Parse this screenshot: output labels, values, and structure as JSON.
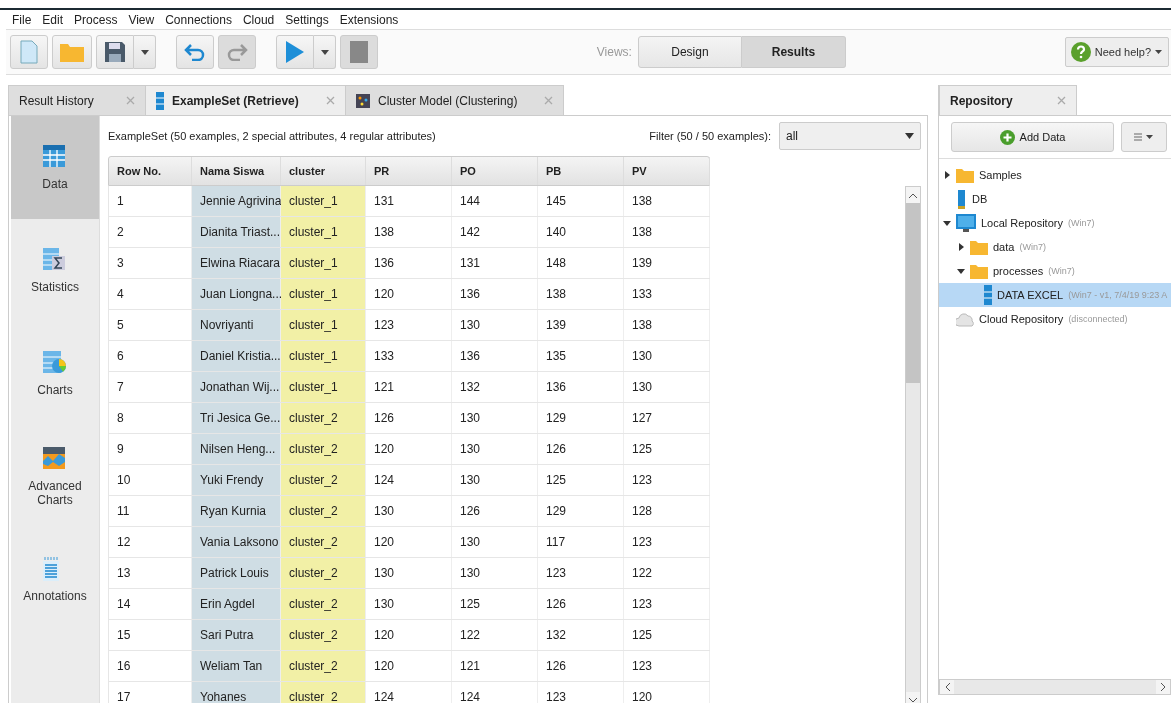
{
  "menu": [
    "File",
    "Edit",
    "Process",
    "View",
    "Connections",
    "Cloud",
    "Settings",
    "Extensions"
  ],
  "toolbar": {
    "views_label": "Views:",
    "views": [
      {
        "label": "Design",
        "selected": false
      },
      {
        "label": "Results",
        "selected": true
      }
    ],
    "help": "Need help?"
  },
  "result_tabs": [
    {
      "label": "Result History",
      "kind": "plain",
      "selected": false
    },
    {
      "label": "ExampleSet (Retrieve)",
      "kind": "table",
      "selected": true
    },
    {
      "label": "Cluster Model (Clustering)",
      "kind": "model",
      "selected": false
    }
  ],
  "side_nav": [
    {
      "label": "Data",
      "kind": "data",
      "selected": true
    },
    {
      "label": "Statistics",
      "kind": "statistics",
      "selected": false
    },
    {
      "label": "Charts",
      "kind": "charts",
      "selected": false
    },
    {
      "label": "Advanced Charts",
      "kind": "advanced",
      "selected": false
    },
    {
      "label": "Annotations",
      "kind": "annotations",
      "selected": false
    }
  ],
  "summary": "ExampleSet (50 examples, 2 special attributes, 4 regular attributes)",
  "filter": {
    "label": "Filter (50 / 50 examples):",
    "value": "all"
  },
  "table": {
    "columns": [
      {
        "label": "Row No.",
        "kind": "regular"
      },
      {
        "label": "Nama Siswa",
        "kind": "id"
      },
      {
        "label": "cluster",
        "kind": "cluster"
      },
      {
        "label": "PR",
        "kind": "regular"
      },
      {
        "label": "PO",
        "kind": "regular"
      },
      {
        "label": "PB",
        "kind": "regular"
      },
      {
        "label": "PV",
        "kind": "regular"
      }
    ],
    "rows": [
      [
        "1",
        "Jennie Agrivina",
        "cluster_1",
        "131",
        "144",
        "145",
        "138"
      ],
      [
        "2",
        "Dianita Triast...",
        "cluster_1",
        "138",
        "142",
        "140",
        "138"
      ],
      [
        "3",
        "Elwina Riacara",
        "cluster_1",
        "136",
        "131",
        "148",
        "139"
      ],
      [
        "4",
        "Juan Liongna...",
        "cluster_1",
        "120",
        "136",
        "138",
        "133"
      ],
      [
        "5",
        "Novriyanti",
        "cluster_1",
        "123",
        "130",
        "139",
        "138"
      ],
      [
        "6",
        "Daniel Kristia...",
        "cluster_1",
        "133",
        "136",
        "135",
        "130"
      ],
      [
        "7",
        "Jonathan Wij...",
        "cluster_1",
        "121",
        "132",
        "136",
        "130"
      ],
      [
        "8",
        "Tri Jesica Ge...",
        "cluster_2",
        "126",
        "130",
        "129",
        "127"
      ],
      [
        "9",
        "Nilsen Heng...",
        "cluster_2",
        "120",
        "130",
        "126",
        "125"
      ],
      [
        "10",
        "Yuki Frendy",
        "cluster_2",
        "124",
        "130",
        "125",
        "123"
      ],
      [
        "11",
        "Ryan Kurnia",
        "cluster_2",
        "130",
        "126",
        "129",
        "128"
      ],
      [
        "12",
        "Vania Laksono",
        "cluster_2",
        "120",
        "130",
        "117",
        "123"
      ],
      [
        "13",
        "Patrick Louis",
        "cluster_2",
        "130",
        "130",
        "123",
        "122"
      ],
      [
        "14",
        "Erin Agdel",
        "cluster_2",
        "130",
        "125",
        "126",
        "123"
      ],
      [
        "15",
        "Sari Putra",
        "cluster_2",
        "120",
        "122",
        "132",
        "125"
      ],
      [
        "16",
        "Weliam Tan",
        "cluster_2",
        "120",
        "121",
        "126",
        "123"
      ],
      [
        "17",
        "Yohanes",
        "cluster_2",
        "124",
        "124",
        "123",
        "120"
      ]
    ]
  },
  "repository": {
    "tab": "Repository",
    "add_data": "Add Data",
    "tree": [
      {
        "label": "Samples",
        "kind": "folder",
        "expanded": false,
        "selected": false
      },
      {
        "label": "DB",
        "kind": "database",
        "selected": false
      },
      {
        "label": "Local Repository",
        "note": "(Win7)",
        "kind": "computer",
        "expanded": true,
        "selected": false,
        "children": [
          {
            "label": "data",
            "note": "(Win7)",
            "kind": "folder",
            "expanded": false,
            "selected": false
          },
          {
            "label": "processes",
            "note": "(Win7)",
            "kind": "folder",
            "expanded": true,
            "selected": false,
            "children": [
              {
                "label": "DATA EXCEL",
                "note": "(Win7 - v1, 7/4/19 9:23 A",
                "kind": "process",
                "selected": true
              }
            ]
          }
        ]
      },
      {
        "label": "Cloud Repository",
        "note": "(disconnected)",
        "kind": "cloud",
        "selected": false
      }
    ]
  }
}
